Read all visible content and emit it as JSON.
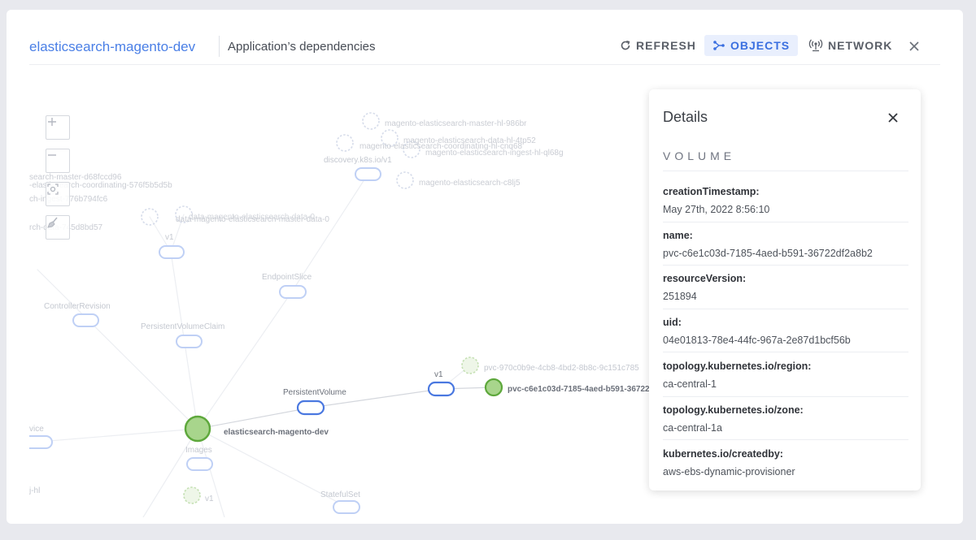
{
  "header": {
    "app_name": "elasticsearch-magento-dev",
    "subtitle": "Application’s dependencies",
    "buttons": {
      "refresh": "REFRESH",
      "objects": "OBJECTS",
      "network": "NETWORK"
    },
    "active_button": "objects"
  },
  "graph": {
    "main_node": "elasticsearch-magento-dev",
    "selected_volume": "pvc-c6e1c03d-7185-4aed-b591-36722",
    "other_volume": "pvc-970c0b9e-4cb8-4bd2-8b8c-9c151c785",
    "edge_labels": {
      "persistent_volume": "PersistentVolume",
      "v1_volume": "v1",
      "images": "Images",
      "stateful_set": "StatefulSet",
      "persistent_volume_claim": "PersistentVolumeClaim",
      "controller_revision": "ControllerRevision",
      "endpoint_slice": "EndpointSlice",
      "v1_claim": "v1",
      "discovery": "discovery.k8s.io/v1",
      "v1_images": "v1",
      "service_partial": "vice",
      "hl_partial": "j-hl"
    },
    "faded_nodes": {
      "master_hl": "magento-elasticsearch-master-hl-986br",
      "data_hl": "magento-elasticsearch-data-hl-4tp52",
      "coordinating_hl": "magento-elasticsearch-coordinating-hl-cnq68",
      "ingest_hl": "magento-elasticsearch-ingest-hl-ql68g",
      "es_c8lj5": "magento-elasticsearch-c8lj5",
      "data_claim": "data-magento-elasticsearch-master-data-0",
      "data_claim_overlap": "data-magento-elasticsearch-data-0",
      "left_master": "search-master-d68fccd96",
      "left_coordinating": "-elasticsearch-coordinating-576f5b5d5b",
      "left_ingest": "ch-ingest-776b794fc6",
      "left_data": "rch-data-745d8bd57"
    },
    "colors": {
      "edge_node": "#4a78e0",
      "faded_edge_node": "#bfd0f5",
      "selected_node_fill": "#a8d58c",
      "selected_node_stroke": "#5ea83c",
      "faded_node": "#c8d2e8"
    }
  },
  "details": {
    "title": "Details",
    "kind": "VOLUME",
    "properties": [
      {
        "key": "creationTimestamp:",
        "value": "May 27th, 2022 8:56:10"
      },
      {
        "key": "name:",
        "value": "pvc-c6e1c03d-7185-4aed-b591-36722df2a8b2"
      },
      {
        "key": "resourceVersion:",
        "value": "251894"
      },
      {
        "key": "uid:",
        "value": "04e01813-78e4-44fc-967a-2e87d1bcf56b"
      },
      {
        "key": "topology.kubernetes.io/region:",
        "value": "ca-central-1"
      },
      {
        "key": "topology.kubernetes.io/zone:",
        "value": "ca-central-1a"
      },
      {
        "key": "kubernetes.io/createdby:",
        "value": "aws-ebs-dynamic-provisioner"
      }
    ]
  }
}
